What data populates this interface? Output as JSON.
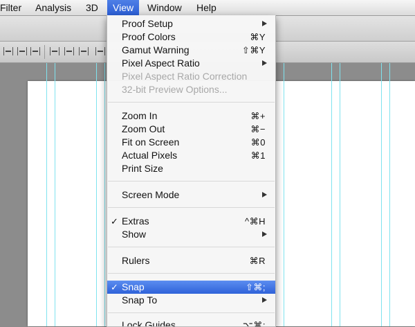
{
  "menubar": {
    "items": [
      "Filter",
      "Analysis",
      "3D",
      "View",
      "Window",
      "Help"
    ]
  },
  "view_menu": {
    "proof_setup": "Proof Setup",
    "proof_colors": "Proof Colors",
    "proof_colors_shortcut": "⌘Y",
    "gamut_warning": "Gamut Warning",
    "gamut_warning_shortcut": "⇧⌘Y",
    "pixel_aspect_ratio": "Pixel Aspect Ratio",
    "pixel_aspect_ratio_correction": "Pixel Aspect Ratio Correction",
    "preview_options": "32-bit Preview Options...",
    "zoom_in": "Zoom In",
    "zoom_in_shortcut": "⌘+",
    "zoom_out": "Zoom Out",
    "zoom_out_shortcut": "⌘−",
    "fit_on_screen": "Fit on Screen",
    "fit_on_screen_shortcut": "⌘0",
    "actual_pixels": "Actual Pixels",
    "actual_pixels_shortcut": "⌘1",
    "print_size": "Print Size",
    "screen_mode": "Screen Mode",
    "extras": "Extras",
    "extras_shortcut": "^⌘H",
    "show": "Show",
    "rulers": "Rulers",
    "rulers_shortcut": "⌘R",
    "snap": "Snap",
    "snap_shortcut": "⇧⌘;",
    "snap_to": "Snap To",
    "lock_guides": "Lock Guides",
    "lock_guides_shortcut": "⌥⌘;",
    "check_mark": "✓"
  }
}
